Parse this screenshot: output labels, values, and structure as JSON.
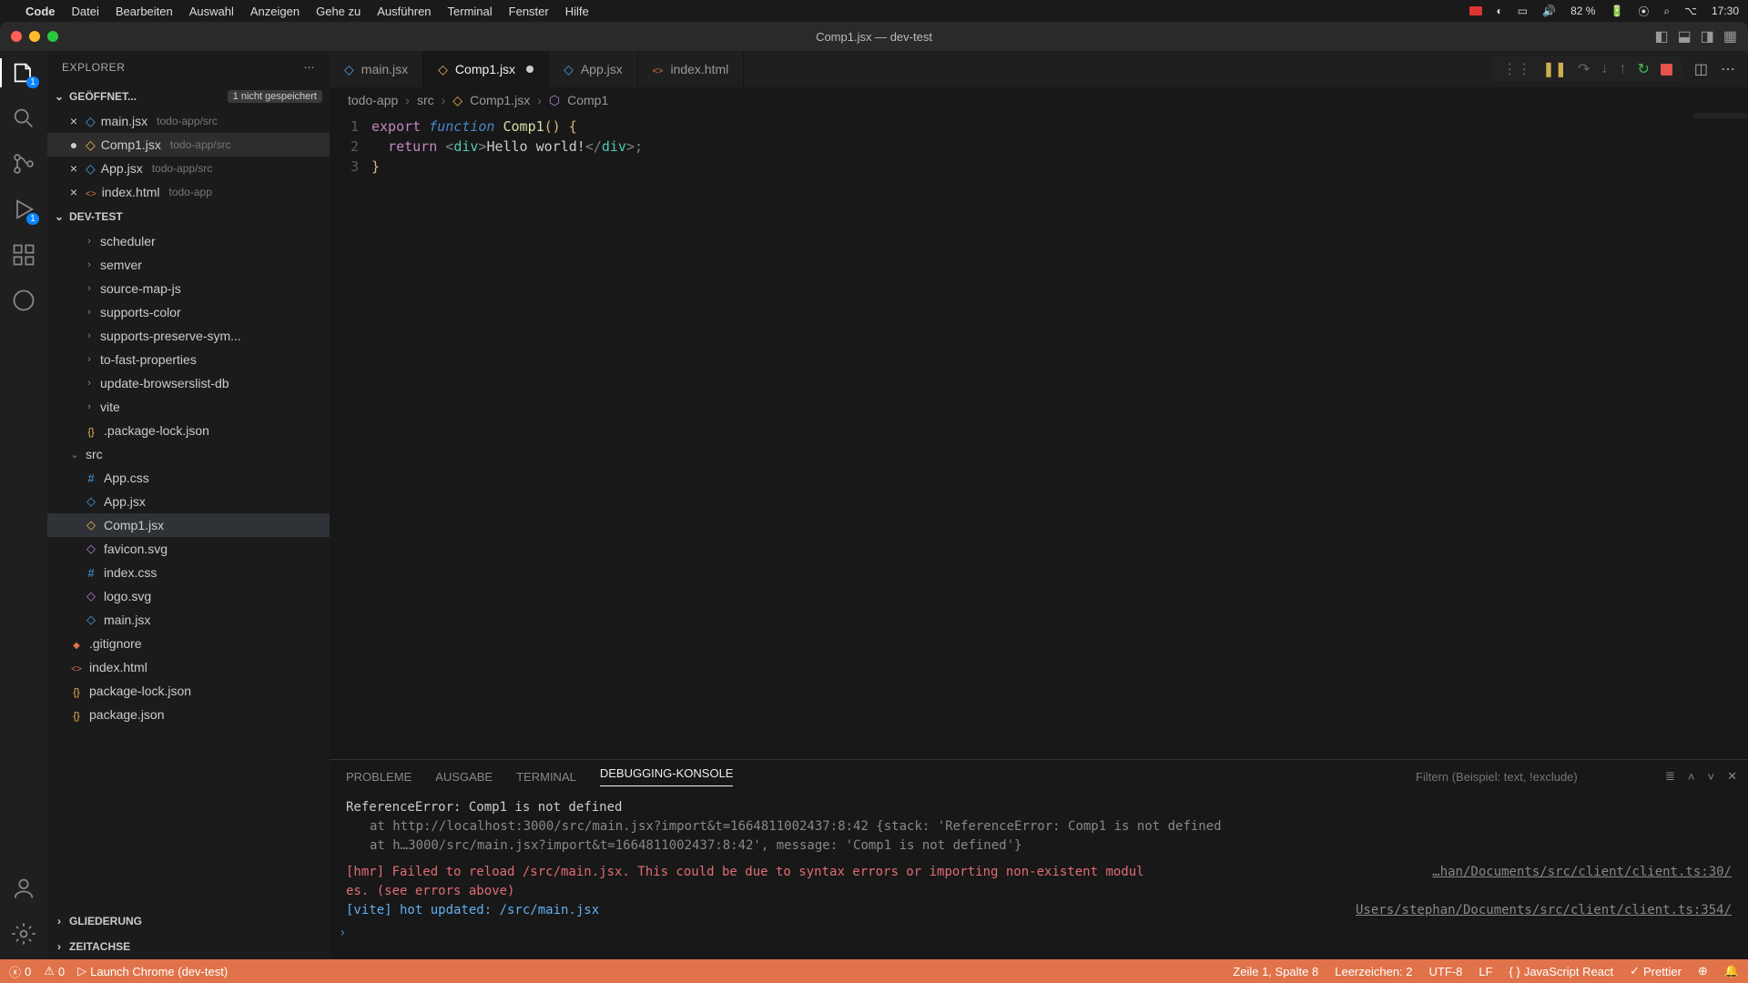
{
  "menubar": {
    "app": "Code",
    "items": [
      "Datei",
      "Bearbeiten",
      "Auswahl",
      "Anzeigen",
      "Gehe zu",
      "Ausführen",
      "Terminal",
      "Fenster",
      "Hilfe"
    ],
    "battery": "82 %",
    "time": "17:30"
  },
  "titlebar": {
    "title": "Comp1.jsx — dev-test"
  },
  "activitybar": {
    "explorer_badge": "1",
    "debug_badge": "1"
  },
  "sidebar": {
    "header": "EXPLORER",
    "open_editors": {
      "title": "GEÖFFNET...",
      "unsaved_tag": "1 nicht gespeichert",
      "items": [
        {
          "name": "main.jsx",
          "path": "todo-app/src",
          "icon": "jsx",
          "modified": false
        },
        {
          "name": "Comp1.jsx",
          "path": "todo-app/src",
          "icon": "jsxc",
          "modified": true,
          "active": true
        },
        {
          "name": "App.jsx",
          "path": "todo-app/src",
          "icon": "jsx",
          "modified": false
        },
        {
          "name": "index.html",
          "path": "todo-app",
          "icon": "html",
          "modified": false
        }
      ]
    },
    "workspace_title": "DEV-TEST",
    "tree": [
      {
        "name": "scheduler",
        "folder": true,
        "indent": 2
      },
      {
        "name": "semver",
        "folder": true,
        "indent": 2
      },
      {
        "name": "source-map-js",
        "folder": true,
        "indent": 2
      },
      {
        "name": "supports-color",
        "folder": true,
        "indent": 2
      },
      {
        "name": "supports-preserve-sym...",
        "folder": true,
        "indent": 2
      },
      {
        "name": "to-fast-properties",
        "folder": true,
        "indent": 2
      },
      {
        "name": "update-browserslist-db",
        "folder": true,
        "indent": 2
      },
      {
        "name": "vite",
        "folder": true,
        "indent": 2
      },
      {
        "name": ".package-lock.json",
        "icon": "json",
        "indent": 2
      },
      {
        "name": "src",
        "folder": true,
        "open": true,
        "indent": 1
      },
      {
        "name": "App.css",
        "icon": "css",
        "indent": 2
      },
      {
        "name": "App.jsx",
        "icon": "jsx",
        "indent": 2
      },
      {
        "name": "Comp1.jsx",
        "icon": "jsxc",
        "indent": 2,
        "selected": true
      },
      {
        "name": "favicon.svg",
        "icon": "svg",
        "indent": 2
      },
      {
        "name": "index.css",
        "icon": "css",
        "indent": 2
      },
      {
        "name": "logo.svg",
        "icon": "svg",
        "indent": 2
      },
      {
        "name": "main.jsx",
        "icon": "jsx",
        "indent": 2
      },
      {
        "name": ".gitignore",
        "icon": "git",
        "indent": 1
      },
      {
        "name": "index.html",
        "icon": "html",
        "indent": 1
      },
      {
        "name": "package-lock.json",
        "icon": "json",
        "indent": 1
      },
      {
        "name": "package.json",
        "icon": "json",
        "indent": 1
      }
    ],
    "outline_title": "GLIEDERUNG",
    "timeline_title": "ZEITACHSE"
  },
  "tabs": [
    {
      "label": "main.jsx",
      "icon": "jsx"
    },
    {
      "label": "Comp1.jsx",
      "icon": "jsxc",
      "active": true,
      "modified": true
    },
    {
      "label": "App.jsx",
      "icon": "jsx"
    },
    {
      "label": "index.html",
      "icon": "html"
    }
  ],
  "breadcrumb": [
    "todo-app",
    "src",
    "Comp1.jsx",
    "Comp1"
  ],
  "code": {
    "lines": [
      "1",
      "2",
      "3"
    ],
    "l1_export": "export",
    "l1_function": "function",
    "l1_name": "Comp1",
    "l1_rest": "() {",
    "l2_return": "return",
    "l2_tag": "div",
    "l2_text": "Hello world!",
    "l3": "}"
  },
  "panel": {
    "tabs": [
      "PROBLEME",
      "AUSGABE",
      "TERMINAL",
      "DEBUGGING-KONSOLE"
    ],
    "active_tab": 3,
    "filter_placeholder": "Filtern (Beispiel: text, !exclude)",
    "output": {
      "err_head": "ReferenceError: Comp1 is not defined",
      "err_l1": "at http://localhost:3000/src/main.jsx?import&t=1664811002437:8:42 {stack: 'ReferenceError: Comp1 is not defined",
      "err_l2": "at h…3000/src/main.jsx?import&t=1664811002437:8:42', message: 'Comp1 is not defined'}",
      "hmr": "[hmr] Failed to reload /src/main.jsx. This could be due to syntax errors or importing non-existent modul",
      "hmr2": "es. (see errors above)",
      "hmr_link": "…han/Documents/src/client/client.ts:30/",
      "vite": "[vite] hot updated: /src/main.jsx",
      "vite_link": "Users/stephan/Documents/src/client/client.ts:354/"
    }
  },
  "statusbar": {
    "errors": "0",
    "warnings": "0",
    "launch": "Launch Chrome (dev-test)",
    "cursor": "Zeile 1, Spalte 8",
    "spaces": "Leerzeichen: 2",
    "encoding": "UTF-8",
    "eol": "LF",
    "lang": "JavaScript React",
    "prettier": "Prettier"
  }
}
